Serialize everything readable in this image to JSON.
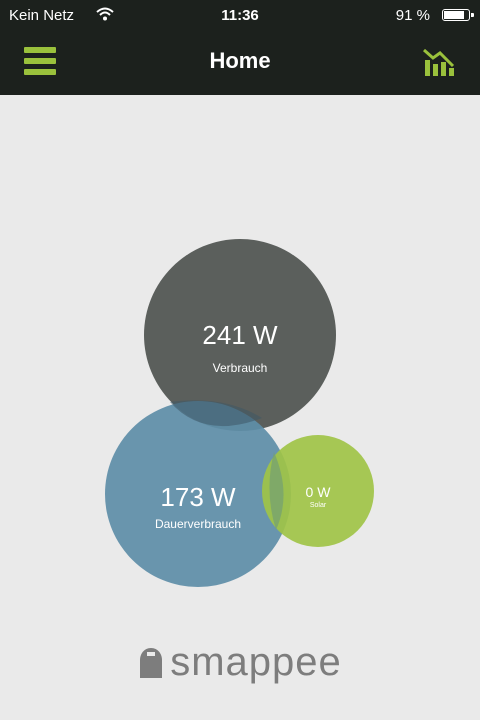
{
  "status_bar": {
    "carrier": "Kein Netz",
    "time": "11:36",
    "battery_label": "91 %",
    "battery_level": 0.91
  },
  "nav": {
    "title": "Home"
  },
  "bubbles": {
    "consumption": {
      "value": "241 W",
      "label": "Verbrauch",
      "color": "#5b5f5c"
    },
    "standby": {
      "value": "173 W",
      "label": "Dauerverbrauch",
      "color": "#5f8ea8"
    },
    "solar": {
      "value": "0 W",
      "label": "Solar",
      "color": "#a0c347"
    }
  },
  "brand": {
    "name": "smappee",
    "accent": "#9ac13c"
  }
}
